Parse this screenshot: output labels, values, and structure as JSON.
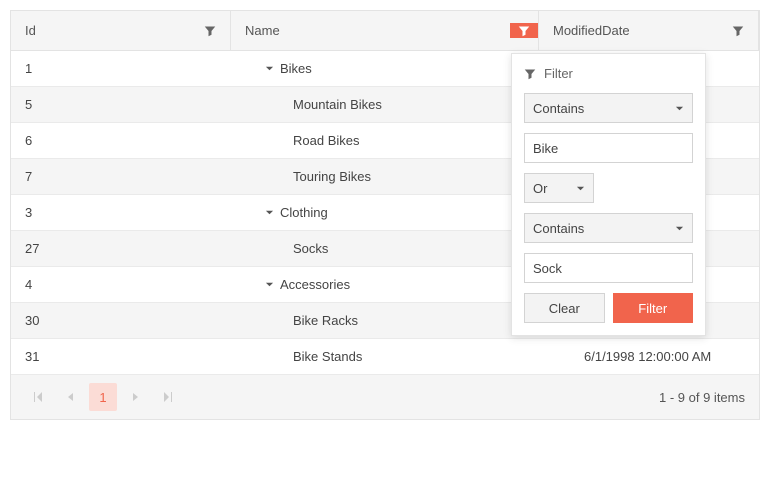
{
  "columns": {
    "id": "Id",
    "name": "Name",
    "date": "ModifiedDate"
  },
  "rows": [
    {
      "id": "1",
      "name": "Bikes",
      "level": 0,
      "expanded": true,
      "alt": false,
      "date": ""
    },
    {
      "id": "5",
      "name": "Mountain Bikes",
      "level": 1,
      "expanded": false,
      "alt": true,
      "date": ""
    },
    {
      "id": "6",
      "name": "Road Bikes",
      "level": 1,
      "expanded": false,
      "alt": false,
      "date": ""
    },
    {
      "id": "7",
      "name": "Touring Bikes",
      "level": 1,
      "expanded": false,
      "alt": true,
      "date": ""
    },
    {
      "id": "3",
      "name": "Clothing",
      "level": 0,
      "expanded": true,
      "alt": false,
      "date": ""
    },
    {
      "id": "27",
      "name": "Socks",
      "level": 1,
      "expanded": false,
      "alt": true,
      "date": ""
    },
    {
      "id": "4",
      "name": "Accessories",
      "level": 0,
      "expanded": true,
      "alt": false,
      "date": ""
    },
    {
      "id": "30",
      "name": "Bike Racks",
      "level": 1,
      "expanded": false,
      "alt": true,
      "date": ""
    },
    {
      "id": "31",
      "name": "Bike Stands",
      "level": 1,
      "expanded": false,
      "alt": false,
      "date": "6/1/1998 12:00:00 AM"
    }
  ],
  "filter_popup": {
    "title": "Filter",
    "condition1_operator": "Contains",
    "condition1_value": "Bike",
    "logic": "Or",
    "condition2_operator": "Contains",
    "condition2_value": "Sock",
    "clear_label": "Clear",
    "filter_label": "Filter"
  },
  "pager": {
    "current_page": "1",
    "summary": "1 - 9 of 9 items"
  }
}
